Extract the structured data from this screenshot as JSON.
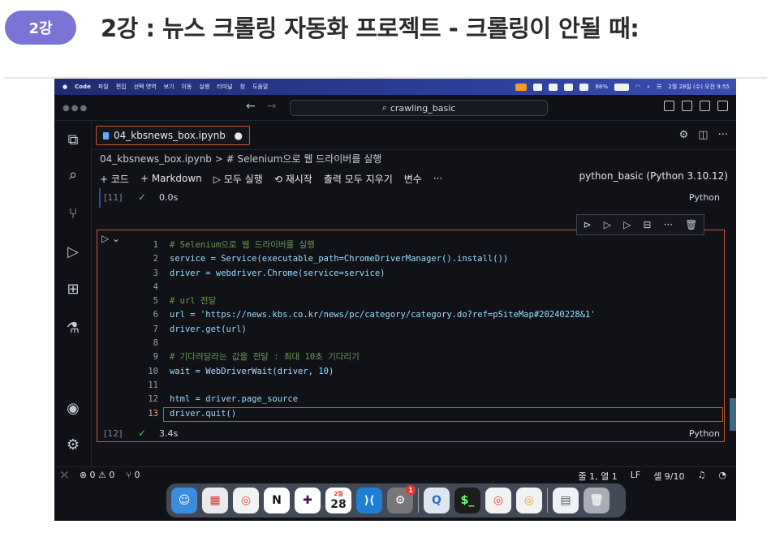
{
  "slide": {
    "badge": "2강",
    "title": "2강 : 뉴스 크롤링 자동화 프로젝트 - 크롤링이 안될 때:"
  },
  "menubar": {
    "items": [
      "Code",
      "파일",
      "편집",
      "선택 영역",
      "보기",
      "이동",
      "실행",
      "터미널",
      "창",
      "도움말"
    ],
    "battery": "88%",
    "datetime": "2월 28일 (수) 오전 9:55"
  },
  "titlebar": {
    "search_text": "crawling_basic",
    "back_arrow": "←",
    "forward_arrow": "→"
  },
  "tab": {
    "filename": "04_kbsnews_box.ipynb",
    "modified_marker": "●"
  },
  "breadcrumb": "04_kbsnews_box.ipynb > # Selenium으로 웹 드라이버를 실행",
  "toolbar": {
    "add_code": "+ 코드",
    "add_markdown": "+ Markdown",
    "run_all": "▷ 모두 실행",
    "restart": "⟲ 재시작",
    "clear_outputs": "출력 모두 지우기",
    "variables": "변수",
    "more": "···",
    "kernel": "python_basic (Python 3.10.12)"
  },
  "prev_cell": {
    "exec_count": "[11]",
    "duration": "0.0s",
    "language": "Python"
  },
  "cell": {
    "exec_count": "[12]",
    "duration": "3.4s",
    "language": "Python",
    "current_line": 13
  },
  "code_lines": [
    "# Selenium으로 웹 드라이버를 실행",
    "service = Service(executable_path=ChromeDriverManager().install())",
    "driver = webdriver.Chrome(service=service)",
    "",
    "# url 전달",
    "url = 'https://news.kbs.co.kr/news/pc/category/category.do?ref=pSiteMap#20240228&1'",
    "driver.get(url)",
    "",
    "# 기다려달라는 값을 전달 : 최대 10초 기다리기",
    "wait = WebDriverWait(driver, 10)",
    "",
    "html = driver.page_source",
    "driver.quit()"
  ],
  "statusbar": {
    "errors": "⊗ 0 ⚠ 0",
    "ports": "⑂ 0",
    "position": "줄 1, 열 1",
    "eol": "LF",
    "cell": "셀 9/10"
  },
  "dock": {
    "calendar_month": "2월",
    "calendar_day": "28",
    "badge_count": "1"
  }
}
